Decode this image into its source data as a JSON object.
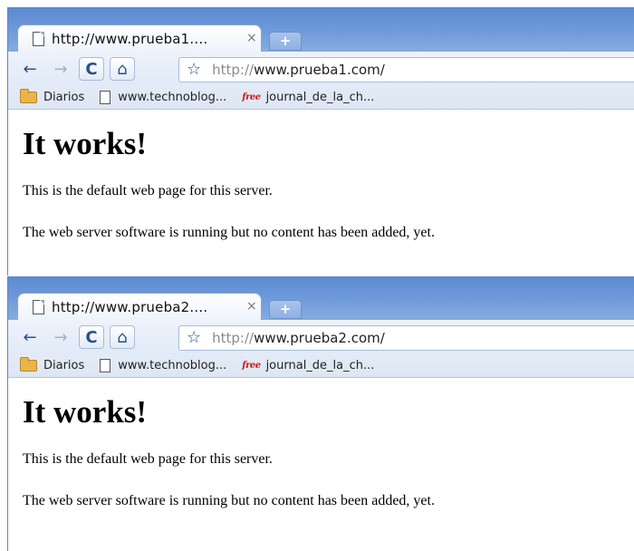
{
  "windows": [
    {
      "tab": {
        "title": "http://www.prueba1....",
        "close": "×",
        "new_tab": "+"
      },
      "toolbar": {
        "back": "←",
        "forward": "→",
        "reload": "C",
        "home": "⌂",
        "star": "☆",
        "url_scheme": "http://",
        "url_host": "www.prueba1.com/"
      },
      "bookmarks": [
        {
          "label": "Diarios",
          "icon": "folder-icon"
        },
        {
          "label": "www.technoblog...",
          "icon": "page-icon"
        },
        {
          "label": "journal_de_la_ch...",
          "icon": "free-icon",
          "icon_text": "free"
        }
      ],
      "page": {
        "heading": "It works!",
        "p1": "This is the default web page for this server.",
        "p2": "The web server software is running but no content has been added, yet."
      }
    },
    {
      "tab": {
        "title": "http://www.prueba2....",
        "close": "×",
        "new_tab": "+"
      },
      "toolbar": {
        "back": "←",
        "forward": "→",
        "reload": "C",
        "home": "⌂",
        "star": "☆",
        "url_scheme": "http://",
        "url_host": "www.prueba2.com/"
      },
      "bookmarks": [
        {
          "label": "Diarios",
          "icon": "folder-icon"
        },
        {
          "label": "www.technoblog...",
          "icon": "page-icon"
        },
        {
          "label": "journal_de_la_ch...",
          "icon": "free-icon",
          "icon_text": "free"
        }
      ],
      "page": {
        "heading": "It works!",
        "p1": "This is the default web page for this server.",
        "p2": "The web server software is running but no content has been added, yet."
      }
    }
  ],
  "colors": {
    "tabstrip": "#6c98da",
    "toolbar": "#e6edf8",
    "accent_icon": "#2a4f8d",
    "free_icon": "#d01818"
  }
}
